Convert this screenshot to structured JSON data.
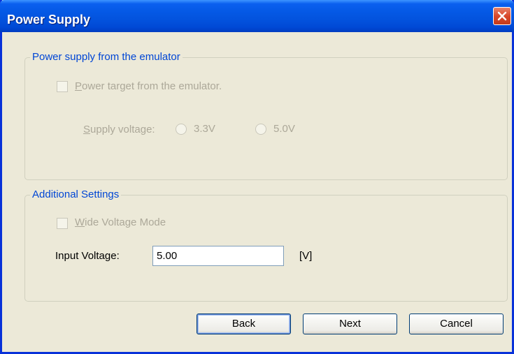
{
  "window": {
    "title": "Power Supply"
  },
  "power_group": {
    "title": "Power supply from the emulator",
    "power_target_label": "Power target from the emulator.",
    "power_target_checked": false,
    "supply_voltage_label": "Supply voltage:",
    "options": [
      "3.3V",
      "5.0V"
    ]
  },
  "additional_group": {
    "title": "Additional Settings",
    "wide_voltage_label": "Wide Voltage Mode",
    "wide_voltage_checked": false,
    "input_voltage_label": "Input Voltage:",
    "input_voltage_value": "5.00",
    "unit": "[V]"
  },
  "buttons": {
    "back": "Back",
    "next": "Next",
    "cancel": "Cancel"
  },
  "colors": {
    "titlebar": "#0458e4",
    "group_title": "#0046d5",
    "disabled_text": "#aca899",
    "dialog_bg": "#ece9d8"
  },
  "icons": {
    "close": "close-icon"
  }
}
